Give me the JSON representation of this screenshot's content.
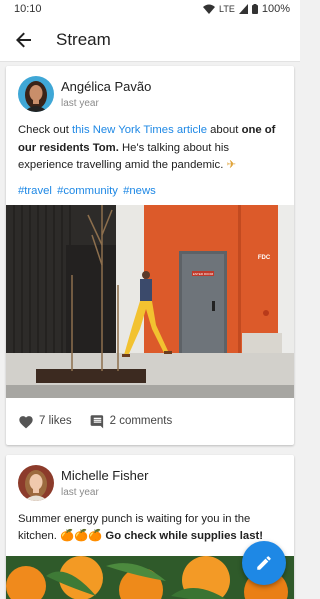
{
  "status_bar": {
    "time": "10:10",
    "network": "LTE",
    "battery": "100%"
  },
  "app_bar": {
    "title": "Stream",
    "back_icon": "arrow-back-icon"
  },
  "posts": [
    {
      "author": "Angélica Pavão",
      "time": "last year",
      "text_parts": [
        {
          "text": "Check out ",
          "style": "normal"
        },
        {
          "text": "this New York Times article",
          "style": "link"
        },
        {
          "text": " about ",
          "style": "normal"
        },
        {
          "text": "one of our residents Tom.",
          "style": "bold"
        },
        {
          "text": " He's talking about his experience travelling amid the pandemic. ",
          "style": "normal"
        },
        {
          "text": "✈",
          "style": "emoji"
        }
      ],
      "tags": [
        "#travel",
        "#community",
        "#news"
      ],
      "image_description_icon": "street-photo-image",
      "image_signs": {
        "door_sign": "ENTER ROOM",
        "building_sign": "FDC"
      },
      "likes": "7 likes",
      "comments": "2 comments"
    },
    {
      "author": "Michelle Fisher",
      "time": "last year",
      "text_parts": [
        {
          "text": "Summer energy punch is waiting for you in the kitchen. ",
          "style": "normal"
        },
        {
          "text": "🍊🍊🍊",
          "style": "emoji"
        },
        {
          "text": " Go check while supplies last!",
          "style": "bold"
        }
      ],
      "image_description_icon": "oranges-photo-image"
    }
  ],
  "fab": {
    "icon": "edit-pencil-icon"
  },
  "colors": {
    "accent": "#1e88e5",
    "background": "#f1f1f1",
    "building_orange": "#dc5a2a"
  }
}
